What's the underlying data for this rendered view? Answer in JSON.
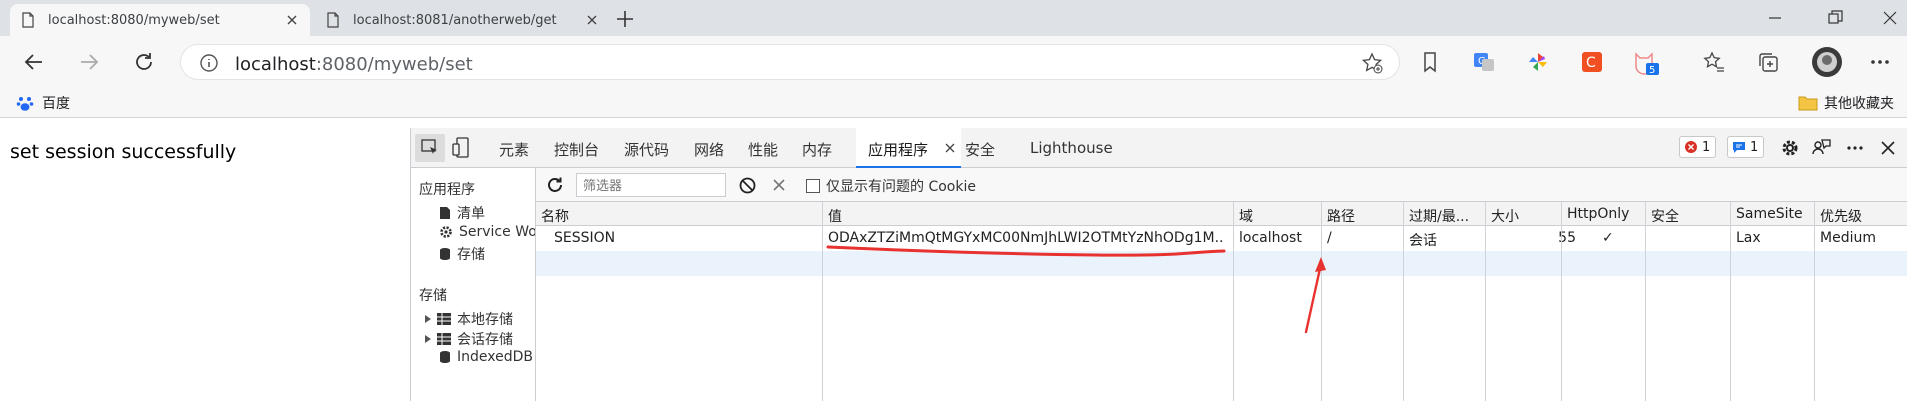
{
  "browser": {
    "tabs": [
      {
        "title": "localhost:8080/myweb/set",
        "active": true
      },
      {
        "title": "localhost:8081/anotherweb/get",
        "active": false
      }
    ],
    "new_tab_icon": "plus-icon",
    "address": {
      "host": "localhost",
      "rest": ":8080/myweb/set"
    },
    "bookmarks": {
      "left": "百度",
      "right": "其他收藏夹"
    },
    "extension_badge": "5"
  },
  "page": {
    "message": "set session successfully"
  },
  "devtools": {
    "tabs": [
      "元素",
      "控制台",
      "源代码",
      "网络",
      "性能",
      "内存",
      "应用程序",
      "安全",
      "Lighthouse"
    ],
    "active_tab": "应用程序",
    "errors_count": "1",
    "messages_count": "1",
    "sidebar": {
      "app_heading": "应用程序",
      "app_items": [
        "清单",
        "Service Wo",
        "存储"
      ],
      "storage_heading": "存储",
      "storage_items": [
        "本地存储",
        "会话存储",
        "IndexedDB"
      ]
    },
    "filter": {
      "placeholder": "筛选器",
      "only_issues_label": "仅显示有问题的 Cookie"
    },
    "table": {
      "columns": [
        "名称",
        "值",
        "域",
        "路径",
        "过期/最...",
        "大小",
        "HttpOnly",
        "安全",
        "SameSite",
        "优先级"
      ],
      "rows": [
        {
          "name": "SESSION",
          "value": "ODAxZTZiMmQtMGYxMC00NmJhLWI2OTMtYzNhODg1M...",
          "domain": "localhost",
          "path": "/",
          "expires": "会话",
          "size": "55",
          "httponly": "✓",
          "secure": "",
          "samesite": "Lax",
          "priority": "Medium"
        }
      ]
    },
    "annotation_color": "#e8322f"
  }
}
